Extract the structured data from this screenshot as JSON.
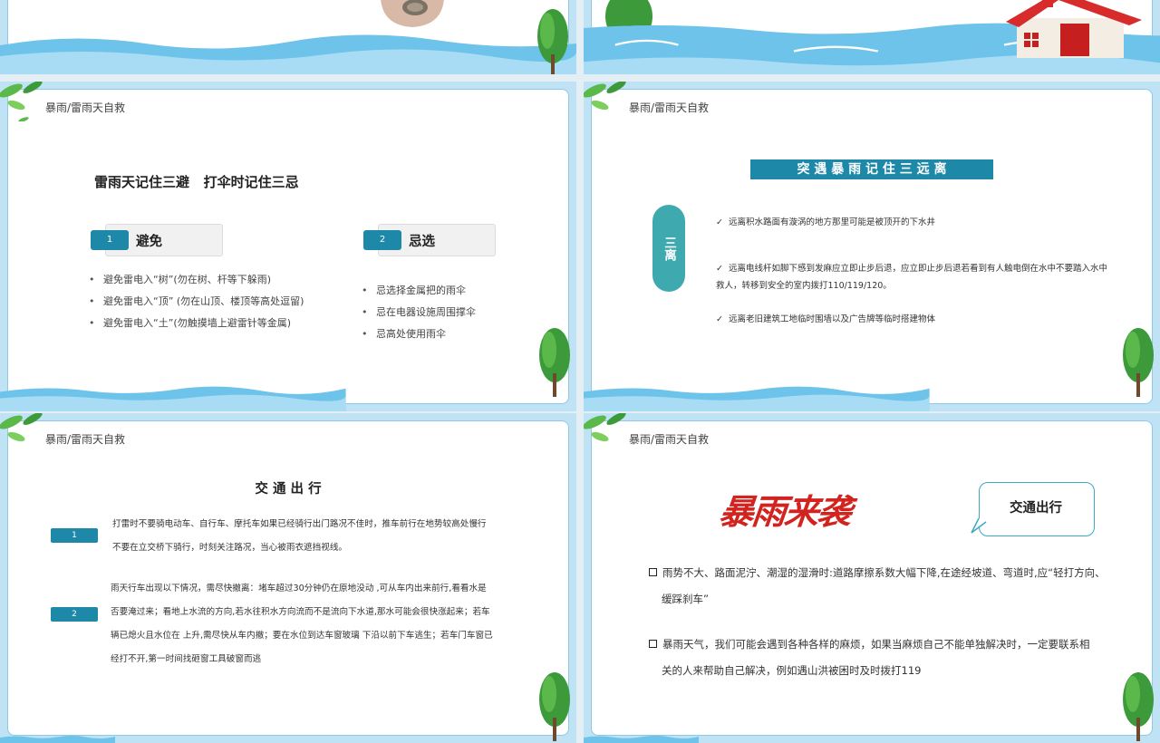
{
  "header": "暴雨/雷雨天自救",
  "slide3": {
    "title": "雷雨天记住三避   打伞时记住三忌",
    "box1": {
      "num": "1",
      "label": "避免"
    },
    "box2": {
      "num": "2",
      "label": "忌选"
    },
    "list1": [
      "避免雷电入“树”(勿在树、杆等下躲雨)",
      "避免雷电入“顶” (勿在山顶、楼顶等高处逗留)",
      "避免雷电入“土”(勿触摸墙上避雷针等金属)"
    ],
    "list2": [
      "忌选择金属把的雨伞",
      "忌在电器设施周围撑伞",
      "忌高处使用雨伞"
    ]
  },
  "slide4": {
    "title": "突 遇 暴 雨 记 住 三 远 离",
    "pill": "三离",
    "items": [
      "远离积水路面有漩涡的地方那里可能是被顶开的下水井",
      "远离电线杆如脚下感到发麻应立即止步后退，应立即止步后退若看到有人触电倒在水中不要踏入水中救人，转移到安全的室内拨打110/119/120。",
      "远离老旧建筑工地临时围墙以及广告牌等临时搭建物体"
    ]
  },
  "slide5": {
    "title": "交 通 出 行",
    "num1": "1",
    "text1": [
      "打雷时不要骑电动车、自行车、摩托车如果已经骑行出门路况不佳时，推车前行在地势较高处慢行",
      "不要在立交桥下骑行，时刻关注路况，当心被雨衣遮挡视线。"
    ],
    "num2": "2",
    "text2": [
      "雨天行车出现以下情况，需尽快撤离：堵车超过30分钟仍在原地没动 ,可从车内出来前行,看看水是",
      "否要淹过来；看地上水流的方向,若水往积水方向流而不是流向下水道,那水可能会很快涨起来；若车",
      "辆已熄火且水位在 上升,需尽快从车内撤；要在水位到达车窗玻璃 下沿以前下车逃生；若车门车窗已",
      "经打不开,第一时间找砸窗工具破窗而逃"
    ]
  },
  "slide6": {
    "calligraphy": "暴雨来袭",
    "bubble": "交通出行",
    "p1": [
      "雨势不大、路面泥泞、潮湿的湿滑时:道路摩擦系数大幅下降,在途经坡道、弯道时,应“轻打方向、",
      "缓踩刹车”"
    ],
    "p2": [
      "暴雨天气，我们可能会遇到各种各样的麻烦，如果当麻烦自己不能单独解决时，一定要联系相",
      "关的人来帮助自己解决，例如遇山洪被困时及时拨打119"
    ]
  },
  "colors": {
    "teal": "#1d88a8",
    "pill": "#3fa9b0",
    "water": "#6ec3ea",
    "red": "#d2231f"
  }
}
